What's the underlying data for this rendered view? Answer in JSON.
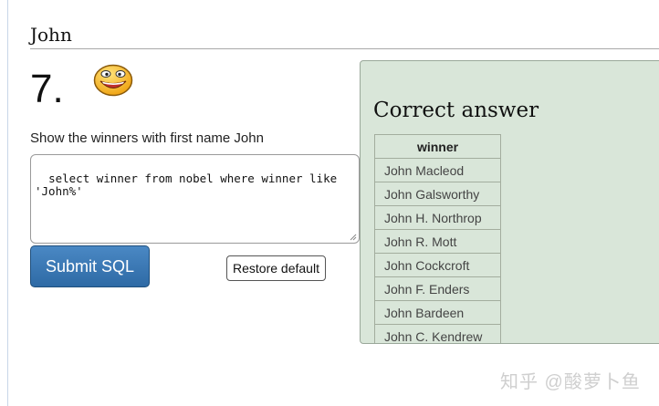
{
  "section": {
    "title": "John"
  },
  "question": {
    "number": "7.",
    "prompt": "Show the winners with first name John",
    "sql": "select winner from nobel where winner like 'John%'",
    "smiley_icon": "smiling-face-icon"
  },
  "buttons": {
    "submit_label": "Submit SQL",
    "restore_label": "Restore default"
  },
  "answer": {
    "title": "Correct answer",
    "column": "winner",
    "rows": [
      "John Macleod",
      "John Galsworthy",
      "John H. Northrop",
      "John R. Mott",
      "John Cockcroft",
      "John F. Enders",
      "John Bardeen",
      "John C. Kendrew"
    ]
  },
  "watermark": "知乎 @酸萝卜鱼",
  "colors": {
    "panel_bg": "#d9e6d9",
    "submit_bg": "#2e6aa5"
  }
}
